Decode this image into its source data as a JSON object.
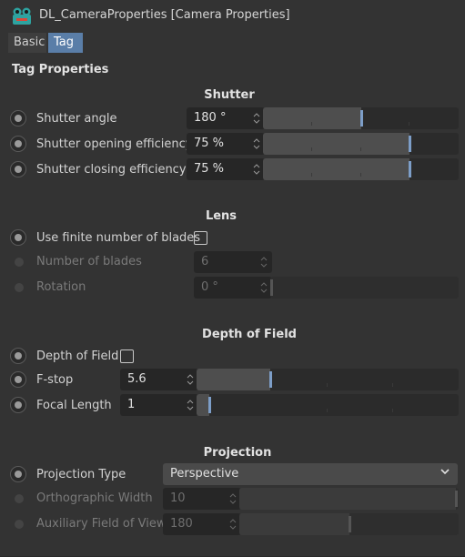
{
  "window": {
    "title": "DL_CameraProperties [Camera Properties]"
  },
  "tabs": [
    {
      "label": "Basic",
      "active": false
    },
    {
      "label": "Tag",
      "active": true
    }
  ],
  "section_title": "Tag Properties",
  "groups": {
    "shutter": {
      "title": "Shutter",
      "rows": [
        {
          "label": "Shutter angle",
          "value": "180 °",
          "slider_fraction": 0.5
        },
        {
          "label": "Shutter opening efficiency",
          "value": "75 %",
          "slider_fraction": 0.75
        },
        {
          "label": "Shutter closing efficiency",
          "value": "75 %",
          "slider_fraction": 0.75
        }
      ]
    },
    "lens": {
      "title": "Lens",
      "use_finite_label": "Use finite number of blades",
      "use_finite_checked": false,
      "blades_label": "Number of blades",
      "blades_value": "6",
      "rotation_label": "Rotation",
      "rotation_value": "0 °",
      "rotation_fraction": 0.0
    },
    "dof": {
      "title": "Depth of Field",
      "dof_label": "Depth of Field",
      "dof_checked": false,
      "fstop_label": "F-stop",
      "fstop_value": "5.6",
      "fstop_fraction": 0.28,
      "focal_label": "Focal Length",
      "focal_value": "1",
      "focal_fraction": 0.05
    },
    "projection": {
      "title": "Projection",
      "type_label": "Projection Type",
      "type_value": "Perspective",
      "ortho_label": "Orthographic Width",
      "ortho_value": "10",
      "ortho_fraction": 1.0,
      "aux_label": "Auxiliary Field of View",
      "aux_value": "180",
      "aux_fraction": 0.5
    }
  },
  "colors": {
    "background": "#333333",
    "accent": "#5a7ea8",
    "slider_handle": "#7d9ec8"
  }
}
